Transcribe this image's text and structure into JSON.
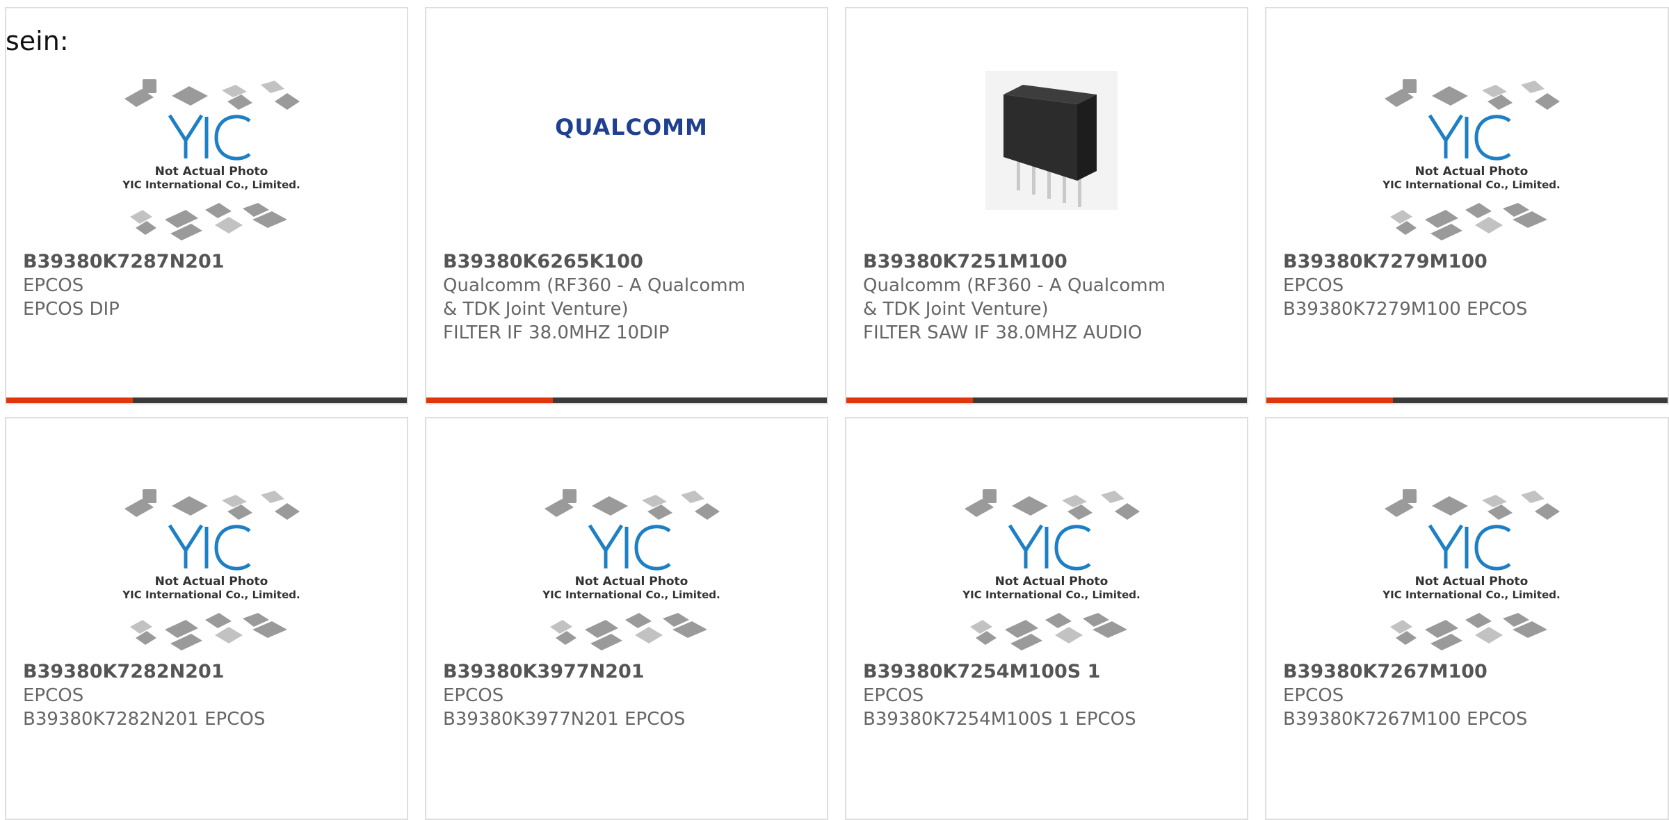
{
  "intro": {
    "text": "sein:"
  },
  "placeholder": {
    "line1": "Not Actual Photo",
    "line2": "YIC International Co., Limited.",
    "logo_text": "YIC"
  },
  "brand_logo_text": "QUALCOMM",
  "colors": {
    "accent": "#e0360e",
    "bar": "#3a3a3a",
    "border": "#dedede",
    "text": "#666666",
    "logo_blue": "#1d7fc4"
  },
  "products": [
    {
      "part_number": "B39380K7287N201",
      "manufacturer": "EPCOS",
      "description": "EPCOS DIP",
      "image": "placeholder"
    },
    {
      "part_number": "B39380K6265K100",
      "manufacturer": "Qualcomm (RF360 - A Qualcomm & TDK Joint Venture)",
      "manufacturer_line1": "Qualcomm (RF360 - A Qualcomm",
      "manufacturer_line2": "& TDK Joint Venture)",
      "description": "FILTER IF 38.0MHZ 10DIP",
      "image": "qualcomm-logo"
    },
    {
      "part_number": "B39380K7251M100",
      "manufacturer": "Qualcomm (RF360 - A Qualcomm & TDK Joint Venture)",
      "manufacturer_line1": "Qualcomm (RF360 - A Qualcomm",
      "manufacturer_line2": "& TDK Joint Venture)",
      "description": "FILTER SAW IF 38.0MHZ AUDIO",
      "image": "component-photo"
    },
    {
      "part_number": "B39380K7279M100",
      "manufacturer": "EPCOS",
      "description": "B39380K7279M100 EPCOS",
      "image": "placeholder"
    },
    {
      "part_number": "B39380K7282N201",
      "manufacturer": "EPCOS",
      "description": "B39380K7282N201 EPCOS",
      "image": "placeholder"
    },
    {
      "part_number": "B39380K3977N201",
      "manufacturer": "EPCOS",
      "description": "B39380K3977N201 EPCOS",
      "image": "placeholder"
    },
    {
      "part_number": "B39380K7254M100S 1",
      "manufacturer": "EPCOS",
      "description": "B39380K7254M100S 1 EPCOS",
      "image": "placeholder"
    },
    {
      "part_number": "B39380K7267M100",
      "manufacturer": "EPCOS",
      "description": "B39380K7267M100 EPCOS",
      "image": "placeholder"
    }
  ]
}
